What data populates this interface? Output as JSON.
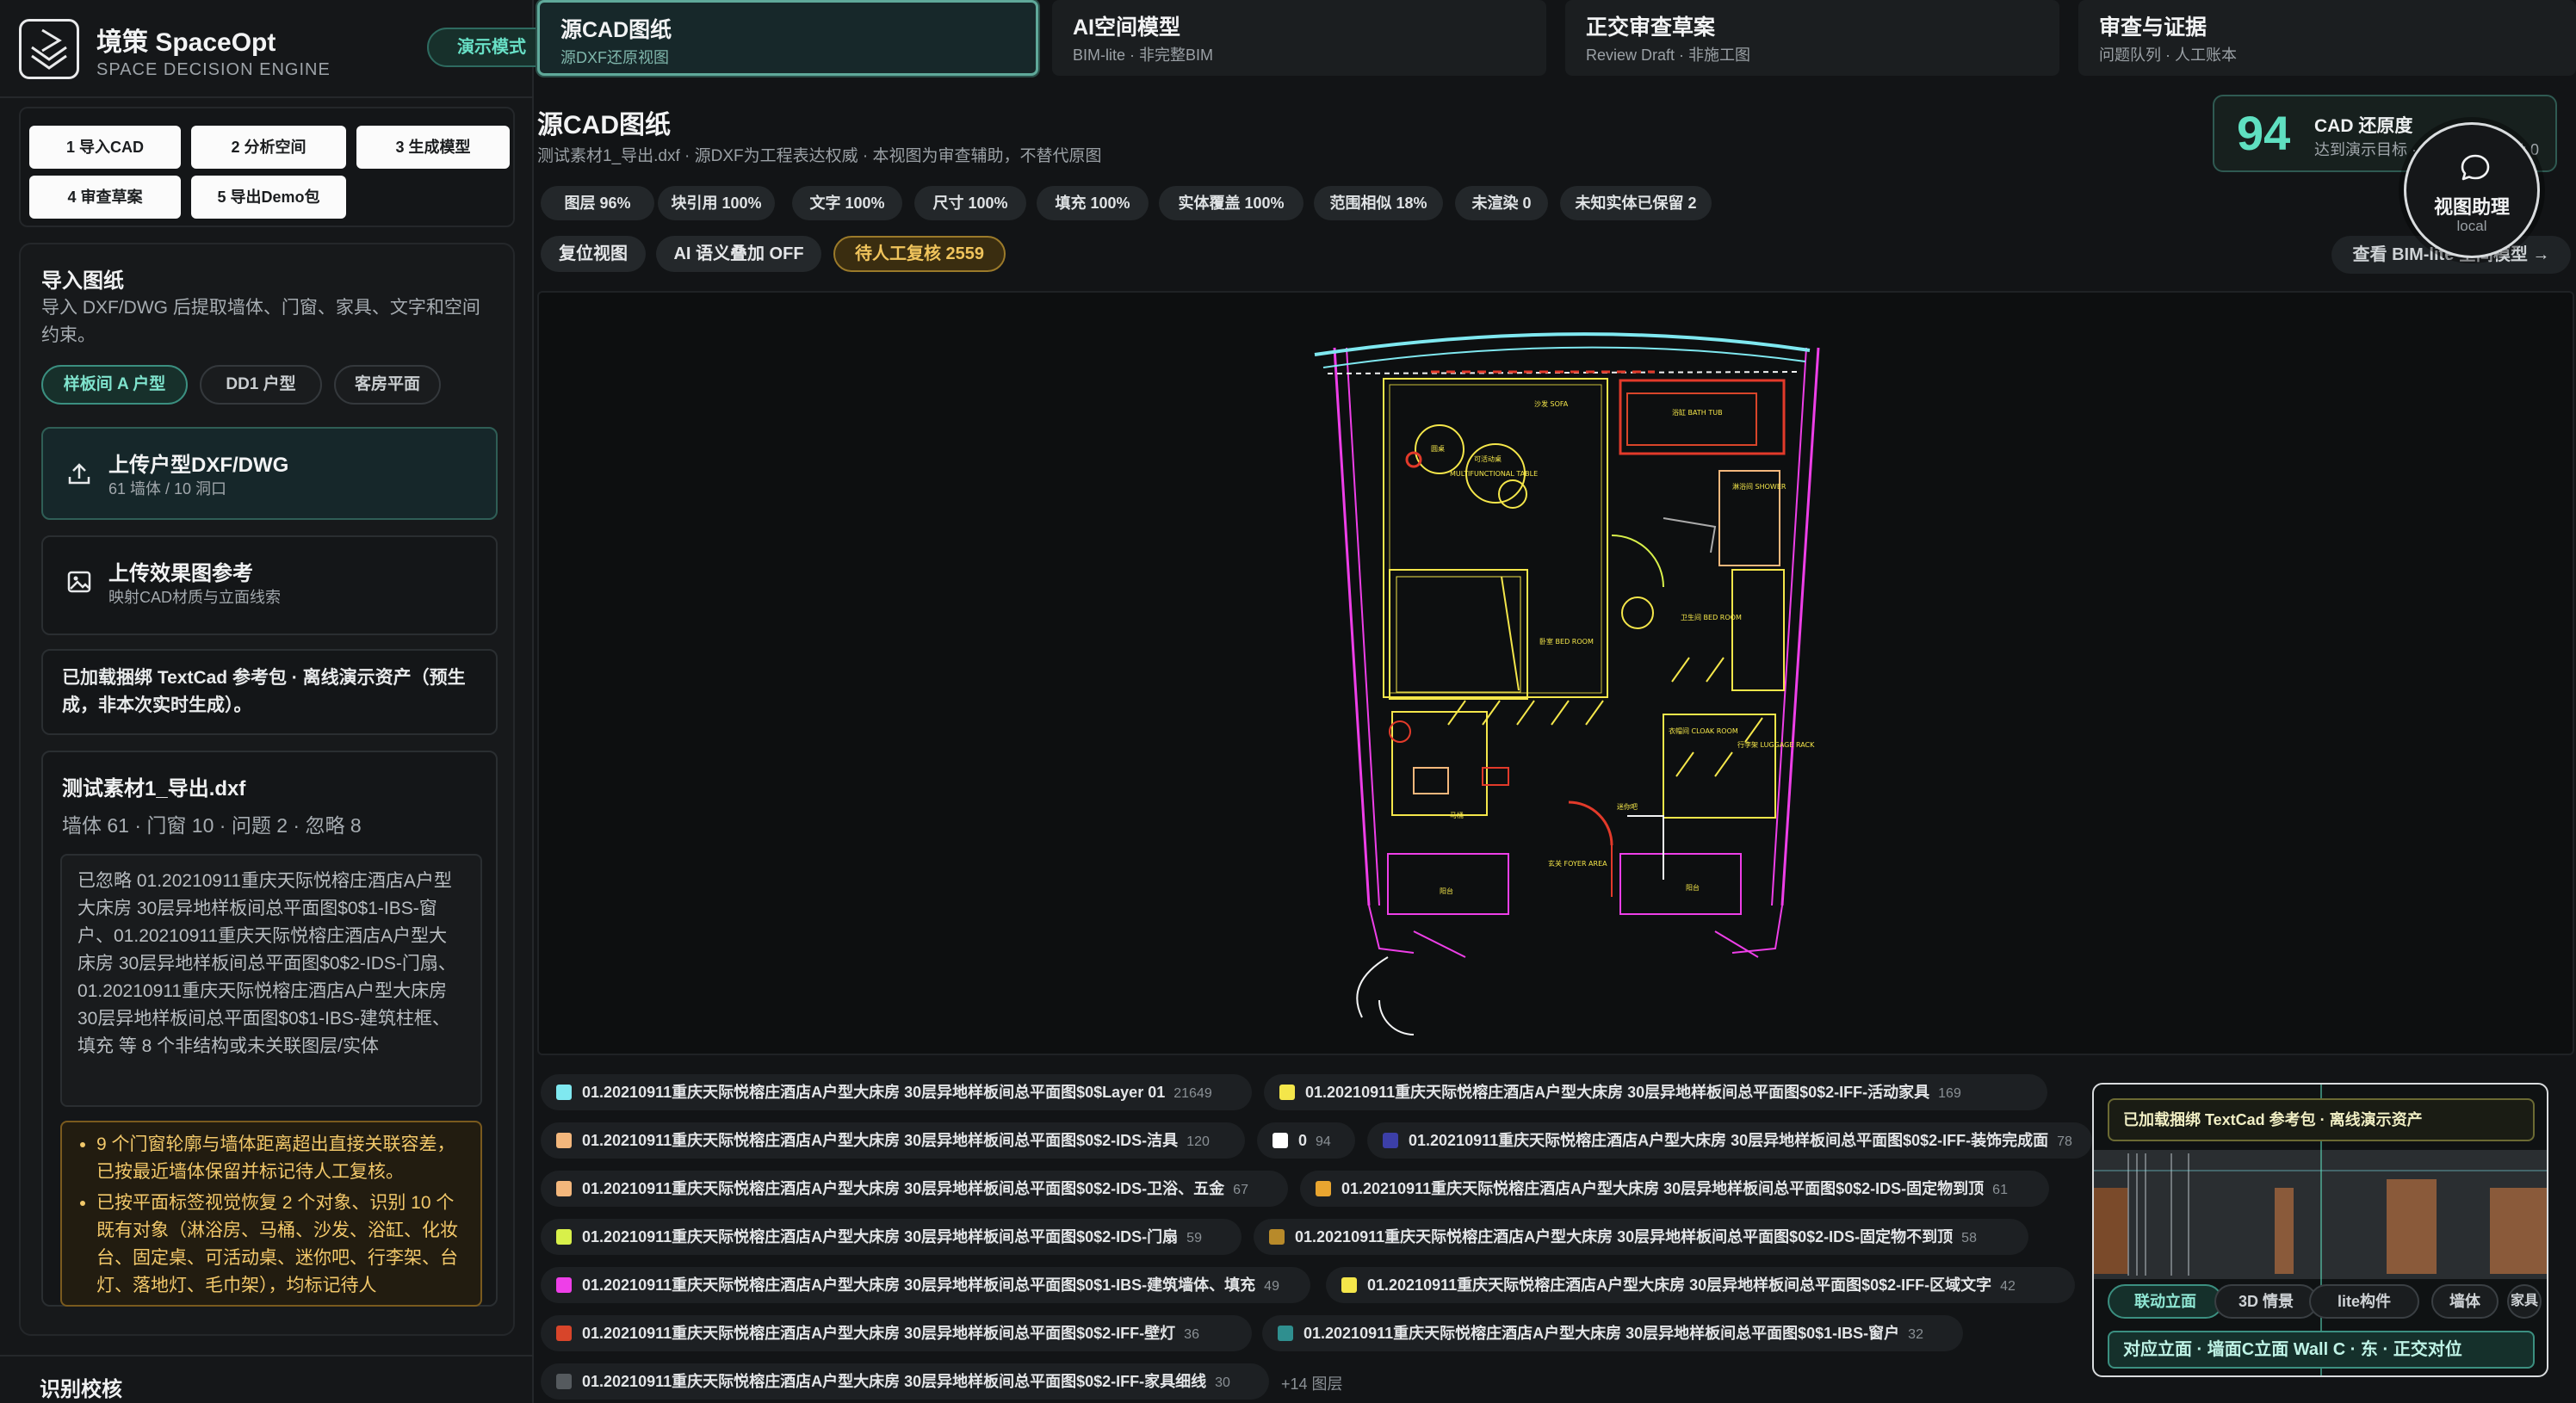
{
  "brand": {
    "title": "境策 SpaceOpt",
    "subtitle": "SPACE DECISION ENGINE",
    "demo_label": "演示模式"
  },
  "steps": [
    "1 导入CAD",
    "2 分析空间",
    "3 生成模型",
    "4 审查草案",
    "5 导出Demo包"
  ],
  "import_panel": {
    "title": "导入图纸",
    "desc": "导入 DXF/DWG 后提取墙体、门窗、家具、文字和空间约束。",
    "chips": [
      "样板间 A 户型",
      "DD1 户型",
      "客房平面"
    ],
    "upload_cad": {
      "title": "上传户型DXF/DWG",
      "sub": "61 墙体 / 10 洞口"
    },
    "upload_ref": {
      "title": "上传效果图参考",
      "sub": "映射CAD材质与立面线索"
    },
    "note": "已加载捆绑 TextCad 参考包 · 离线演示资产（预生成，非本次实时生成）。",
    "file": {
      "name": "测试素材1_导出.dxf",
      "stats": "墙体 61 · 门窗 10 · 问题 2 · 忽略 8",
      "ignored": "已忽略 01.20210911重庆天际悦榕庄酒店A户型大床房 30层异地样板间总平面图$0$1-IBS-窗户、01.20210911重庆天际悦榕庄酒店A户型大床房 30层异地样板间总平面图$0$2-IDS-门扇、01.20210911重庆天际悦榕庄酒店A户型大床房 30层异地样板间总平面图$0$1-IBS-建筑柱框、填充 等 8 个非结构或未关联图层/实体",
      "warnings": [
        "9 个门窗轮廓与墙体距离超出直接关联容差，已按最近墙体保留并标记待人工复核。",
        "已按平面标签视觉恢复 2 个对象、识别 10 个既有对象（淋浴房、马桶、沙发、浴缸、化妆台、固定桌、可活动桌、迷你吧、行李架、台灯、落地灯、毛巾架），均标记待人"
      ]
    },
    "next_section": "识别校核"
  },
  "tabs": [
    {
      "title": "源CAD图纸",
      "sub": "源DXF还原视图"
    },
    {
      "title": "AI空间模型",
      "sub": "BIM-lite · 非完整BIM"
    },
    {
      "title": "正交审查草案",
      "sub": "Review Draft · 非施工图"
    },
    {
      "title": "审查与证据",
      "sub": "问题队列 · 人工账本"
    }
  ],
  "main": {
    "title": "源CAD图纸",
    "subtitle": "测试素材1_导出.dxf · 源DXF为工程表达权威 · 本视图为审查辅助，不替代原图",
    "stats": [
      "图层 96%",
      "块引用 100%",
      "文字 100%",
      "尺寸 100%",
      "填充 100%",
      "实体覆盖 100%",
      "范围相似 18%",
      "未渲染 0",
      "未知实体已保留 2"
    ],
    "actions": [
      "复位视图",
      "AI 语义叠加 OFF",
      "待人工复核 2559"
    ],
    "bim_link": "查看 BIM-lite 空间模型 →"
  },
  "score": {
    "value": "94",
    "label": "CAD 还原度",
    "sub": "达到演示目标 ·",
    "tail": "染 0"
  },
  "assistant": {
    "title": "视图助理",
    "sub": "local"
  },
  "layers": [
    {
      "name": "01.20210911重庆天际悦榕庄酒店A户型大床房 30层异地样板间总平面图$0$Layer 01",
      "count": "21649",
      "color": "#7fe8f0"
    },
    {
      "name": "01.20210911重庆天际悦榕庄酒店A户型大床房 30层异地样板间总平面图$0$2-IFF-活动家具",
      "count": "169",
      "color": "#f4e64a"
    },
    {
      "name": "01.20210911重庆天际悦榕庄酒店A户型大床房 30层异地样板间总平面图$0$2-IDS-洁具",
      "count": "120",
      "color": "#f3b77c"
    },
    {
      "name": "0",
      "count": "94",
      "color": "#ffffff"
    },
    {
      "name": "01.20210911重庆天际悦榕庄酒店A户型大床房 30层异地样板间总平面图$0$2-IFF-装饰完成面",
      "count": "78",
      "color": "#3c3fa8"
    },
    {
      "name": "01.20210911重庆天际悦榕庄酒店A户型大床房 30层异地样板间总平面图$0$2-IDS-卫浴、五金",
      "count": "67",
      "color": "#f3b77c"
    },
    {
      "name": "01.20210911重庆天际悦榕庄酒店A户型大床房 30层异地样板间总平面图$0$2-IDS-固定物到顶",
      "count": "61",
      "color": "#e8a530"
    },
    {
      "name": "01.20210911重庆天际悦榕庄酒店A户型大床房 30层异地样板间总平面图$0$2-IDS-门扇",
      "count": "59",
      "color": "#d8f04a"
    },
    {
      "name": "01.20210911重庆天际悦榕庄酒店A户型大床房 30层异地样板间总平面图$0$2-IDS-固定物不到顶",
      "count": "58",
      "color": "#b88a2a"
    },
    {
      "name": "01.20210911重庆天际悦榕庄酒店A户型大床房 30层异地样板间总平面图$0$1-IBS-建筑墙体、填充",
      "count": "49",
      "color": "#ee3fe8"
    },
    {
      "name": "01.20210911重庆天际悦榕庄酒店A户型大床房 30层异地样板间总平面图$0$2-IFF-区域文字",
      "count": "42",
      "color": "#f4e64a"
    },
    {
      "name": "01.20210911重庆天际悦榕庄酒店A户型大床房 30层异地样板间总平面图$0$2-IFF-壁灯",
      "count": "36",
      "color": "#d8452a"
    },
    {
      "name": "01.20210911重庆天际悦榕庄酒店A户型大床房 30层异地样板间总平面图$0$1-IBS-窗户",
      "count": "32",
      "color": "#2f8f8f"
    },
    {
      "name": "01.20210911重庆天际悦榕庄酒店A户型大床房 30层异地样板间总平面图$0$2-IFF-家具细线",
      "count": "30",
      "color": "#555a5e"
    }
  ],
  "more_layers": "+14 图层",
  "mini": {
    "banner": "已加载捆绑 TextCad 参考包 · 离线演示资产",
    "pills": [
      "联动立面",
      "3D 情景",
      "lite构件",
      "墙体",
      "家具"
    ],
    "footer": "对应立面 · 墙面C立面 Wall C · 东 · 正交对位"
  },
  "plan_labels": [
    "沙发 SOFA",
    "浴缸 BATH TUB",
    "圆桌",
    "可活动桌",
    "MULTIFUNCTIONAL TABLE",
    "淋浴间 SHOWER",
    "卧室 BED ROOM",
    "卫生间 BED ROOM",
    "衣帽间 CLOAK ROOM",
    "行李架 LUGGAGE RACK",
    "玄关 FOYER AREA",
    "阳台",
    "阳台",
    "马桶",
    "迷你吧"
  ]
}
